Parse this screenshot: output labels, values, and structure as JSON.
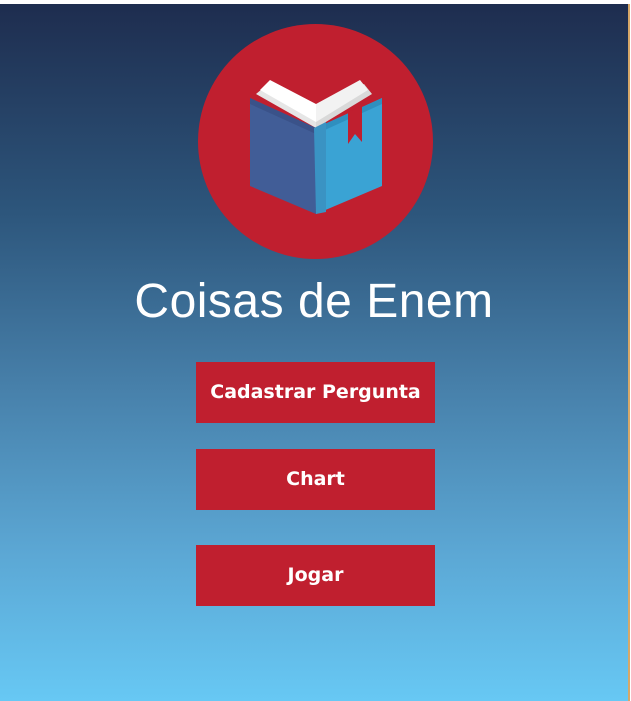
{
  "app": {
    "logo_icon": "open-book-icon",
    "title": "Coisas de Enem"
  },
  "menu": {
    "cadastrar_label": "Cadastrar Pergunta",
    "chart_label": "Chart",
    "jogar_label": "Jogar"
  },
  "colors": {
    "accent_red": "#c01f2f",
    "gradient_top": "#1e2d4f",
    "gradient_bottom": "#67c8f4",
    "text": "#ffffff"
  }
}
